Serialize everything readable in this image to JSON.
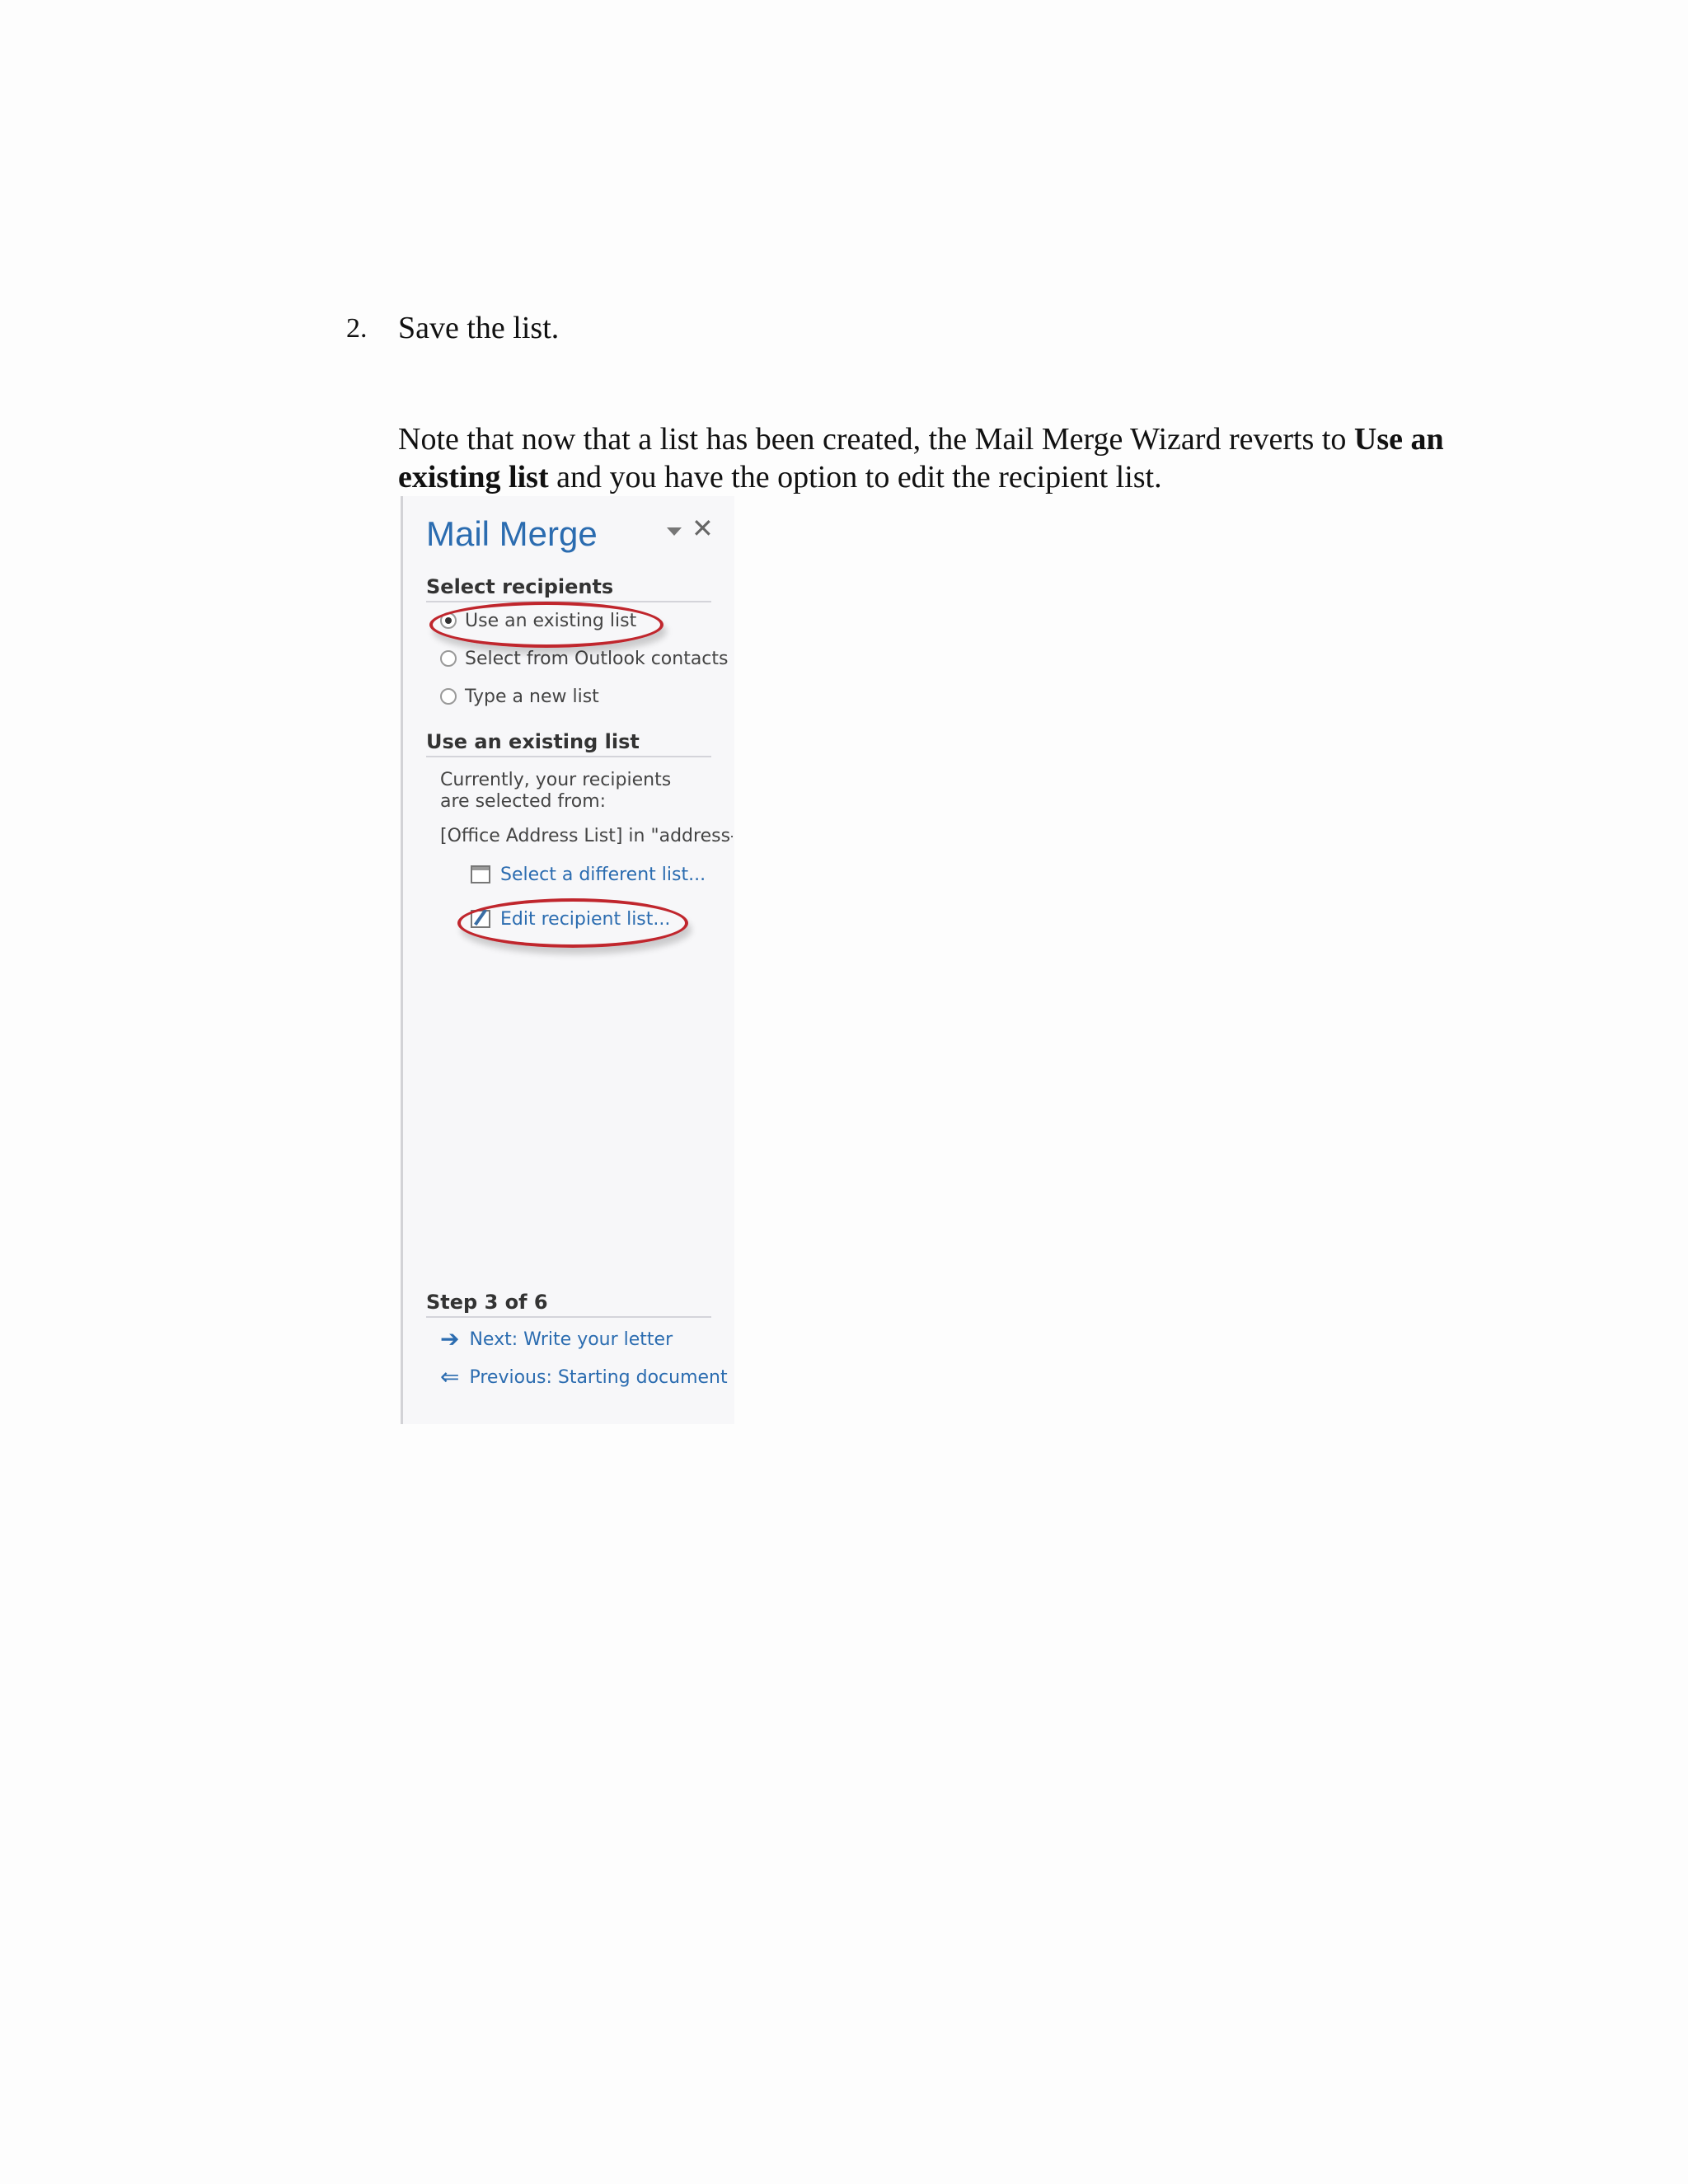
{
  "document": {
    "step_number": "2.",
    "step_text": "Save the list.",
    "note_before": "Note that now that a list has been created, the Mail Merge Wizard reverts to ",
    "note_bold": "Use an existing list",
    "note_after": " and you have the option to edit the recipient list."
  },
  "pane": {
    "title": "Mail Merge",
    "select_recipients": {
      "heading": "Select recipients",
      "options": [
        {
          "label": "Use an existing list",
          "selected": true
        },
        {
          "label": "Select from Outlook contacts",
          "selected": false
        },
        {
          "label": "Type a new list",
          "selected": false
        }
      ]
    },
    "existing_list": {
      "heading": "Use an existing list",
      "description": "Currently, your recipients are selected from:",
      "source": "[Office Address List] in \"address-l",
      "select_link": "Select a different list...",
      "edit_link": "Edit recipient list..."
    },
    "step": {
      "heading": "Step 3 of 6",
      "next": "Next: Write your letter",
      "previous": "Previous: Starting document"
    }
  },
  "annotation_color": "#c0262d",
  "icons": [
    "chevron-down-icon",
    "close-icon",
    "list-icon",
    "edit-icon",
    "arrow-right-icon",
    "arrow-left-icon"
  ]
}
